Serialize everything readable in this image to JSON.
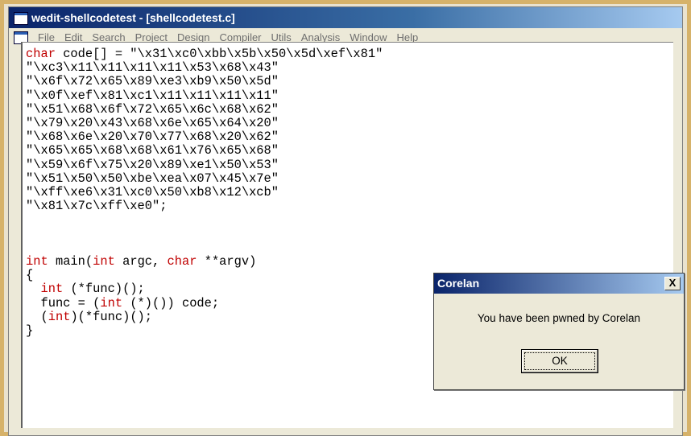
{
  "window": {
    "title": "wedit-shellcodetest - [shellcodetest.c]"
  },
  "menu": {
    "items": [
      "File",
      "Edit",
      "Search",
      "Project",
      "Design",
      "Compiler",
      "Utils",
      "Analysis",
      "Window",
      "Help"
    ]
  },
  "code": {
    "line1_kw": "char",
    "line1_rest": " code[] = \"\\x31\\xc0\\xbb\\x5b\\x50\\x5d\\xef\\x81\"",
    "line2": "\"\\xc3\\x11\\x11\\x11\\x11\\x53\\x68\\x43\"",
    "line3": "\"\\x6f\\x72\\x65\\x89\\xe3\\xb9\\x50\\x5d\"",
    "line4": "\"\\x0f\\xef\\x81\\xc1\\x11\\x11\\x11\\x11\"",
    "line5": "\"\\x51\\x68\\x6f\\x72\\x65\\x6c\\x68\\x62\"",
    "line6": "\"\\x79\\x20\\x43\\x68\\x6e\\x65\\x64\\x20\"",
    "line7": "\"\\x68\\x6e\\x20\\x70\\x77\\x68\\x20\\x62\"",
    "line8": "\"\\x65\\x65\\x68\\x68\\x61\\x76\\x65\\x68\"",
    "line9": "\"\\x59\\x6f\\x75\\x20\\x89\\xe1\\x50\\x53\"",
    "line10": "\"\\x51\\x50\\x50\\xbe\\xea\\x07\\x45\\x7e\"",
    "line11": "\"\\xff\\xe6\\x31\\xc0\\x50\\xb8\\x12\\xcb\"",
    "line12": "\"\\x81\\x7c\\xff\\xe0\";",
    "main_kw1": "int",
    "main_mid": " main(",
    "main_kw2": "int",
    "main_mid2": " argc, ",
    "main_kw3": "char",
    "main_end": " **argv)",
    "brace_open": "{",
    "b1_kw": "int",
    "b1_rest": " (*func)();",
    "b2_pre": "  func = (",
    "b2_kw": "int",
    "b2_rest": " (*)()) code;",
    "b3_pre": "  (",
    "b3_kw": "int",
    "b3_rest": ")(*func)();",
    "brace_close": "}"
  },
  "dialog": {
    "title": "Corelan",
    "close_label": "X",
    "message": "You have been pwned by Corelan",
    "ok_label": "OK"
  }
}
